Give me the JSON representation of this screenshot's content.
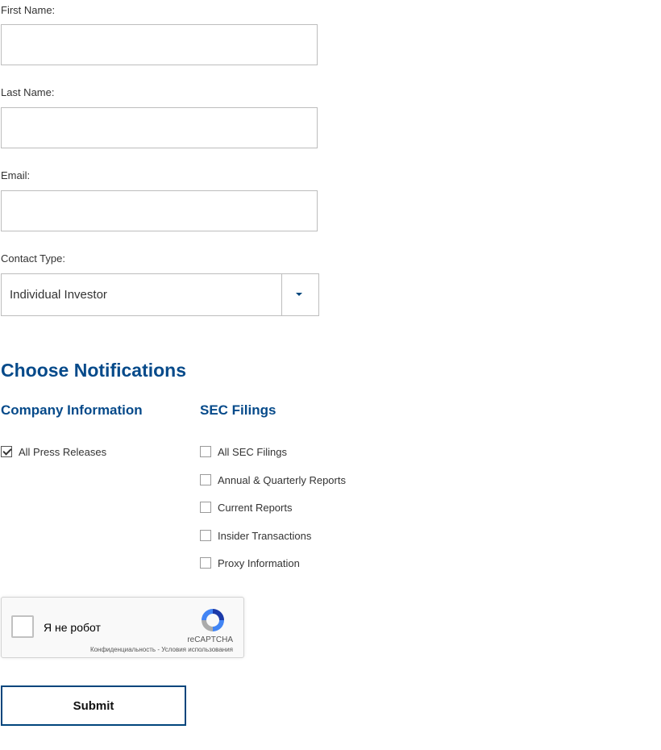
{
  "form": {
    "first_name": {
      "label": "First Name:",
      "value": ""
    },
    "last_name": {
      "label": "Last Name:",
      "value": ""
    },
    "email": {
      "label": "Email:",
      "value": ""
    },
    "contact_type": {
      "label": "Contact Type:",
      "selected": "Individual Investor"
    }
  },
  "notifications": {
    "title": "Choose Notifications",
    "company": {
      "title": "Company Information",
      "items": [
        {
          "label": "All Press Releases",
          "checked": true
        }
      ]
    },
    "sec": {
      "title": "SEC Filings",
      "items": [
        {
          "label": "All SEC Filings",
          "checked": false
        },
        {
          "label": "Annual & Quarterly Reports",
          "checked": false
        },
        {
          "label": "Current Reports",
          "checked": false
        },
        {
          "label": "Insider Transactions",
          "checked": false
        },
        {
          "label": "Proxy Information",
          "checked": false
        }
      ]
    }
  },
  "captcha": {
    "label": "Я не робот",
    "brand": "reCAPTCHA",
    "privacy": "Конфиденциальность",
    "separator": " - ",
    "terms": "Условия использования",
    "icon": "recaptcha-logo"
  },
  "submit_label": "Submit",
  "colors": {
    "heading": "#064a8a",
    "button_border": "#00457c"
  }
}
